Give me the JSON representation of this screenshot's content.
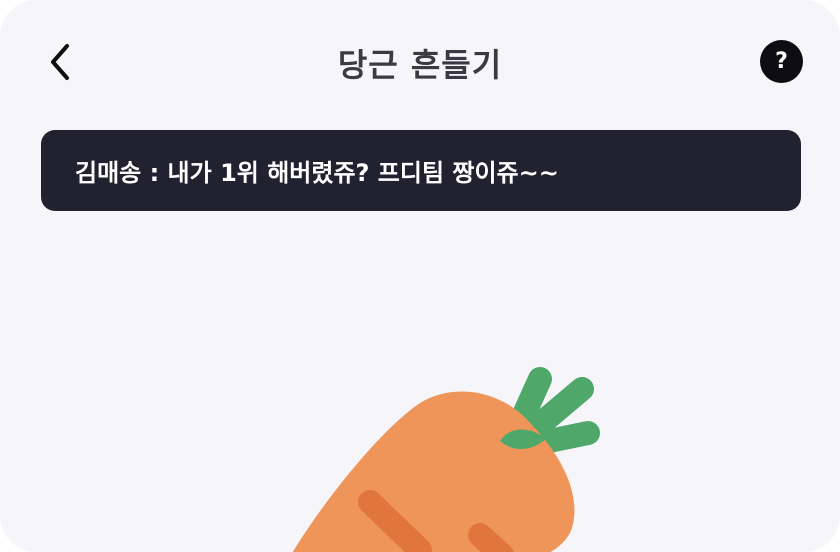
{
  "header": {
    "title": "당근 흔들기",
    "back_icon": "chevron-left-icon",
    "help_icon": "question-mark-icon",
    "help_label": "?"
  },
  "banner": {
    "message": "김매송 : 내가 1위 해버렸쥬? 프디팀 짱이쥬~~"
  },
  "colors": {
    "background": "#f6f5fa",
    "banner_bg": "#222130",
    "carrot_body": "#f0955a",
    "carrot_stripe": "#e0763c",
    "carrot_leaves": "#4fa86a"
  }
}
